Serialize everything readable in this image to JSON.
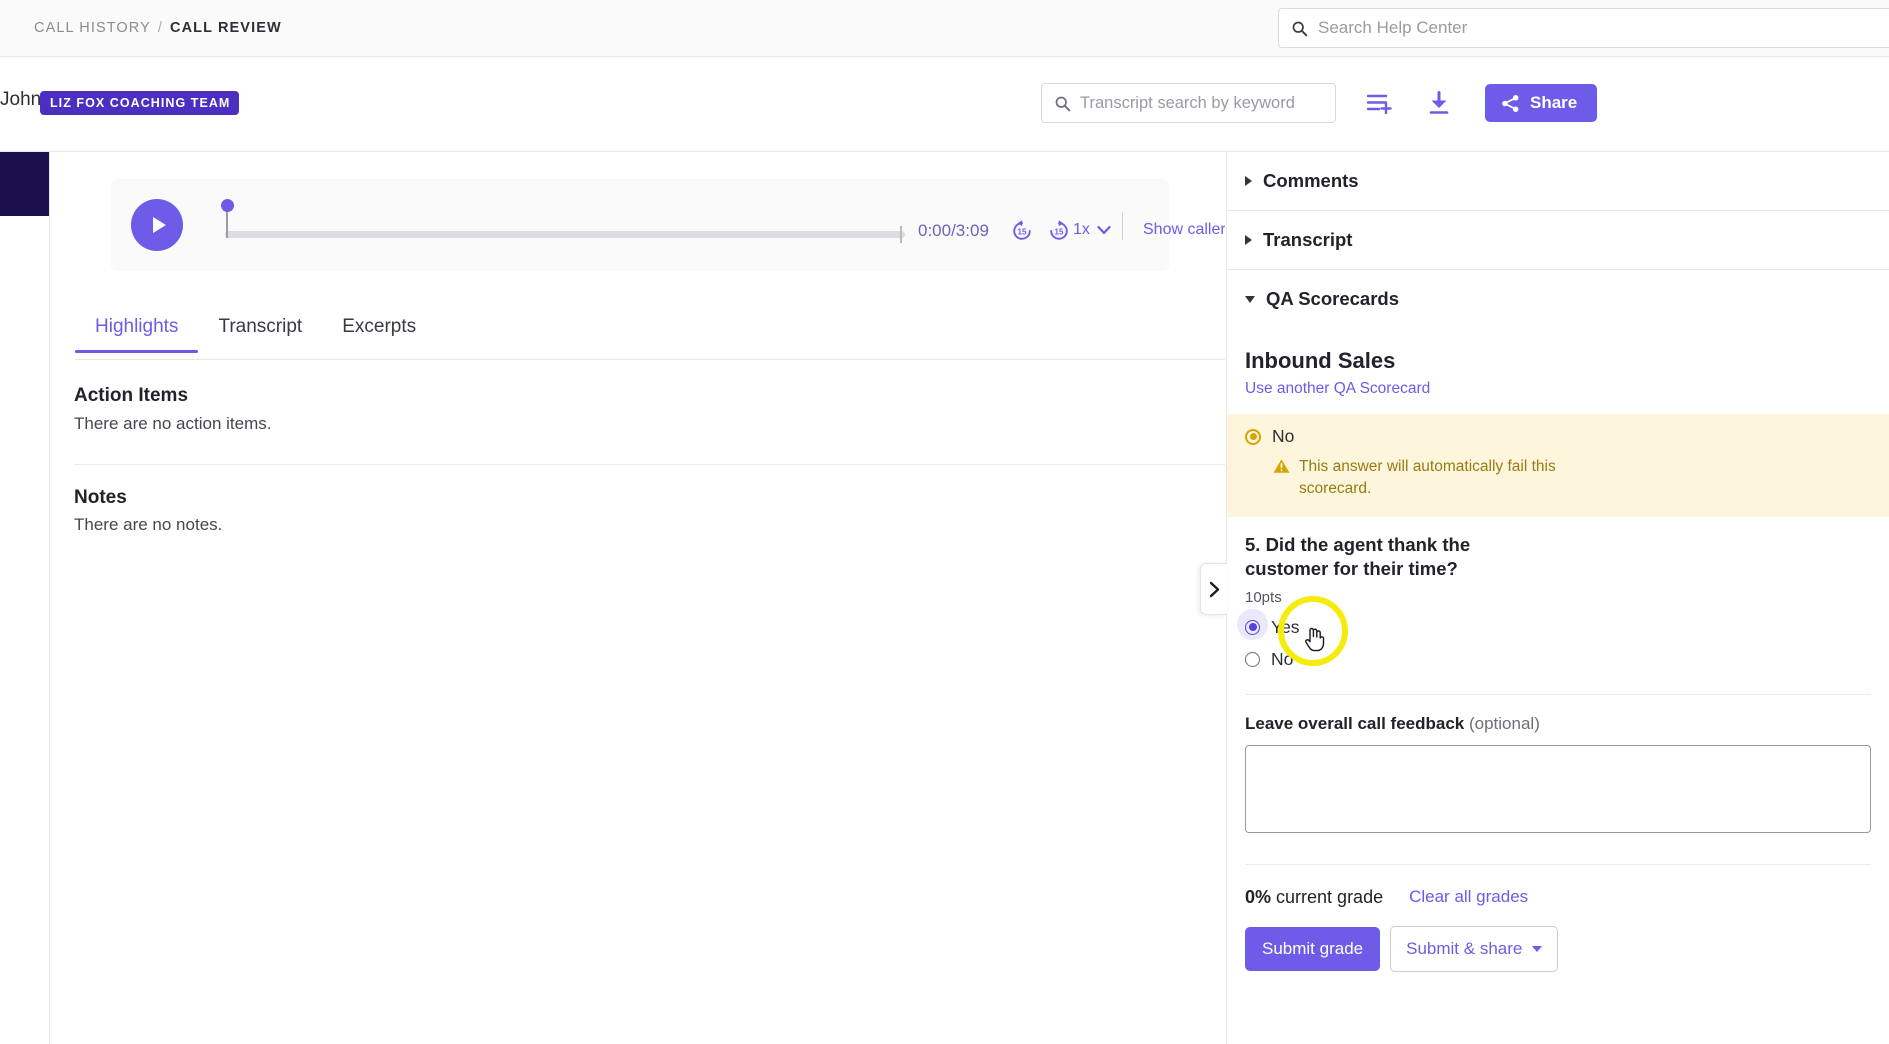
{
  "breadcrumb": {
    "parent": "CALL HISTORY",
    "separator": "/",
    "current": "CALL REVIEW"
  },
  "help_search": {
    "placeholder": "Search Help Center",
    "icon": "search-icon"
  },
  "call_header": {
    "agent_name": "John",
    "team_badge": "LIZ FOX COACHING TEAM",
    "transcript_search_placeholder": "Transcript search by keyword",
    "playlist_icon": "playlist-add-icon",
    "download_icon": "download-icon",
    "share_label": "Share",
    "share_icon": "share-icon"
  },
  "player": {
    "play_icon": "play-icon",
    "time": "0:00/3:09",
    "current_time": "0:00",
    "duration": "3:09",
    "skip_back_label": "15",
    "skip_forward_label": "15",
    "speed": "1x",
    "speed_caret": "chevron-down-icon",
    "show_callers": "Show callers"
  },
  "tabs": [
    {
      "label": "Highlights",
      "active": true
    },
    {
      "label": "Transcript",
      "active": false
    },
    {
      "label": "Excerpts",
      "active": false
    }
  ],
  "highlights": {
    "action_items_title": "Action Items",
    "action_items_empty": "There are no action items.",
    "notes_title": "Notes",
    "notes_empty": "There are no notes."
  },
  "sidebar": {
    "collapse_icon": "chevron-right-icon",
    "accordions": [
      {
        "label": "Comments",
        "expanded": false,
        "icon": "triangle-right-icon"
      },
      {
        "label": "Transcript",
        "expanded": false,
        "icon": "triangle-right-icon"
      },
      {
        "label": "QA Scorecards",
        "expanded": true,
        "icon": "triangle-down-icon"
      }
    ],
    "scorecard": {
      "name": "Inbound Sales",
      "use_another_link": "Use another QA Scorecard",
      "failing_answer": {
        "option_label": "No",
        "selected": true,
        "warning_icon": "warning-triangle-icon",
        "warning_text": "This answer will automatically fail this scorecard."
      },
      "question": {
        "title": "5. Did the agent thank the customer for their time?",
        "points": "10pts",
        "options": [
          {
            "label": "Yes",
            "selected": true
          },
          {
            "label": "No",
            "selected": false
          }
        ]
      },
      "feedback": {
        "label_bold": "Leave overall call feedback",
        "label_optional": "(optional)",
        "value": "",
        "placeholder": ""
      },
      "grade": {
        "percent": "0%",
        "percent_suffix": "current grade",
        "clear_link": "Clear all grades",
        "submit_label": "Submit grade",
        "submit_share_label": "Submit & share",
        "submit_share_caret": "caret-down-icon"
      }
    }
  },
  "colors": {
    "accent": "#6c5ce7",
    "badge": "#4b2fc0",
    "warning_bg": "#fdf6dd",
    "warning_text": "#9a7a12",
    "rail": "#1b0f4d",
    "cursor_highlight": "#f5ec0e"
  }
}
